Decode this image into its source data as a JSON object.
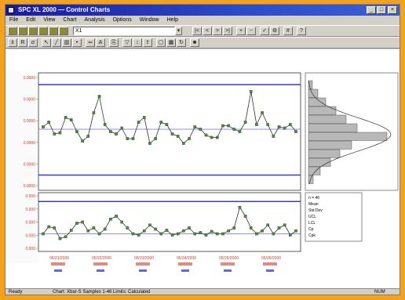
{
  "window": {
    "title": "SPC XL 2000 — Control Charts",
    "min_glyph": "_",
    "max_glyph": "□",
    "close_glyph": "×"
  },
  "menu": [
    "File",
    "Edit",
    "View",
    "Chart",
    "Analysis",
    "Options",
    "Window",
    "Help"
  ],
  "toolbar": {
    "selector_value": "X1"
  },
  "colors": {
    "accent": "#1c1c9a",
    "limit_line": "#3a3ad0",
    "center_line": "#6a6ae0",
    "point": "#4e8a3a",
    "axis_label": "#d03a2a",
    "date_label": "#1a2bd0"
  },
  "chart_data": [
    {
      "type": "line",
      "y_ticks": [
        "0.0000",
        "0.0000",
        "0.0000",
        "0.0000",
        "0.0000",
        "0.0000"
      ],
      "values": [
        0.54,
        0.58,
        0.48,
        0.49,
        0.62,
        0.6,
        0.5,
        0.42,
        0.46,
        0.66,
        0.8,
        0.56,
        0.5,
        0.48,
        0.53,
        0.44,
        0.44,
        0.58,
        0.62,
        0.4,
        0.44,
        0.58,
        0.56,
        0.48,
        0.46,
        0.4,
        0.44,
        0.54,
        0.52,
        0.47,
        0.45,
        0.45,
        0.55,
        0.55,
        0.52,
        0.5,
        0.58,
        0.84,
        0.56,
        0.66,
        0.56,
        0.46,
        0.54,
        0.53,
        0.56,
        0.5
      ],
      "ucl": 0.9,
      "center": 0.52,
      "lcl": 0.13,
      "ylim": [
        0,
        1
      ]
    },
    {
      "type": "bar",
      "name": "histogram",
      "values": [
        0.05,
        0.12,
        0.22,
        0.35,
        0.48,
        0.62,
        1.0,
        0.55,
        0.4,
        0.28,
        0.15,
        0.06
      ]
    },
    {
      "type": "line",
      "values": [
        0.3,
        0.42,
        0.4,
        0.22,
        0.25,
        0.36,
        0.48,
        0.5,
        0.35,
        0.4,
        0.3,
        0.38,
        0.55,
        0.6,
        0.5,
        0.4,
        0.3,
        0.28,
        0.35,
        0.45,
        0.38,
        0.3,
        0.36,
        0.28,
        0.3,
        0.35,
        0.4,
        0.3,
        0.32,
        0.28,
        0.34,
        0.3,
        0.3,
        0.35,
        0.4,
        0.75,
        0.6,
        0.4,
        0.3,
        0.35,
        0.45,
        0.3,
        0.4,
        0.45,
        0.28,
        0.35
      ],
      "center": 0.3,
      "ucl": 0.85,
      "ylim": [
        0,
        1
      ]
    }
  ],
  "lower_y_ticks": [
    "0.000",
    "0.000",
    "0.000",
    "0.000",
    "0.000"
  ],
  "date_labels": [
    "05/21/2000",
    "05/22/2000",
    "05/23/2000",
    "05/24/2000",
    "05/25/2000",
    "05/26/2000"
  ],
  "stats_box": [
    "n = 46",
    "Mean",
    "Std Dev",
    "UCL",
    "LCL",
    "Cp",
    "Cpk"
  ],
  "status": {
    "left": "Ready",
    "mid": "Chart: Xbar-S   Samples 1-46   Limits: Calculated",
    "right": "NUM"
  }
}
